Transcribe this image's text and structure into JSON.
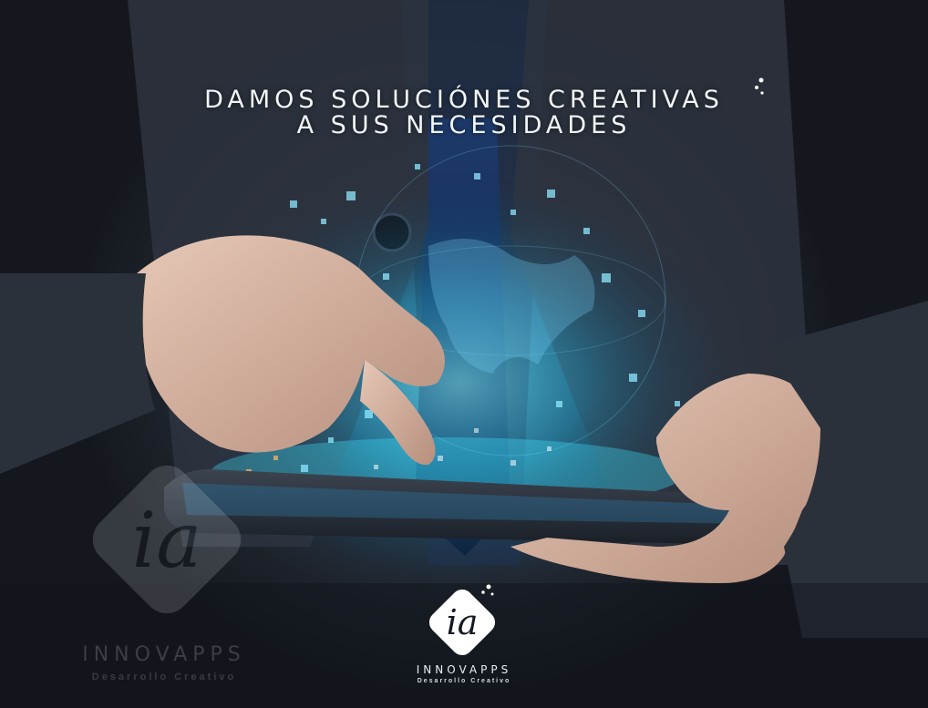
{
  "hero": {
    "headline_line1": "DAMOS SOLUCIÓNES CREATIVAS",
    "headline_line2": "A SUS NECESIDADES"
  },
  "brand": {
    "logo_text": "ia",
    "name": "INNOVAPPS",
    "tagline": "Desarrollo Creativo"
  },
  "watermark": {
    "logo_text": "ia",
    "name": "INNOVAPPS",
    "tagline": "Desarrollo Creativo"
  },
  "colors": {
    "glow": "#2fd0ff",
    "suit": "#3a4250",
    "text": "#f2f6fa"
  }
}
